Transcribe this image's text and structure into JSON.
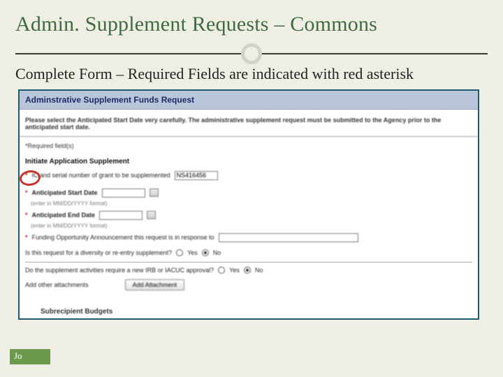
{
  "title": "Admin. Supplement Requests – Commons",
  "subtitle": "Complete Form – Required Fields are indicated with red asterisk",
  "form": {
    "header": "Adminstrative Supplement Funds Request",
    "instruction": "Please select the Anticipated Start Date very carefully. The administrative supplement request must be submitted to the Agency prior to the anticipated start date.",
    "required_note": "*Required field(s)",
    "section": "Initiate Application Supplement",
    "grant_label": "IC and serial number of grant to be supplemented",
    "grant_value": "NS416456",
    "start_label": "Anticipated Start Date",
    "start_hint": "(enter in MM/DD/YYYY format)",
    "end_label": "Anticipated End Date",
    "end_hint": "(enter in MM/DD/YYYY format)",
    "foa_label": "Funding Opportunity Announcement this request is in response to",
    "diversity_label": "Is this request for a diversity or re-entry supplement?",
    "irb_label": "Do the supplement activities require a new IRB or IACUC approval?",
    "yes": "Yes",
    "no": "No",
    "attach_label": "Add other attachments",
    "attach_btn": "Add Attachment",
    "sub_budgets": "Subrecipient Budgets"
  },
  "footer_fragment": "Jo"
}
